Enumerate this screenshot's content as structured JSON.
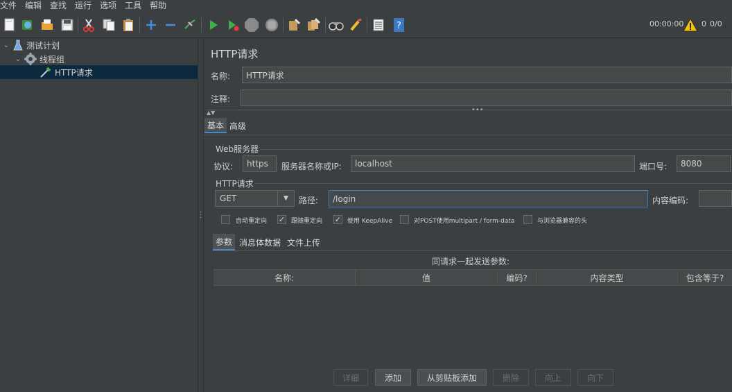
{
  "menu": [
    "文件",
    "编辑",
    "查找",
    "运行",
    "选项",
    "工具",
    "帮助"
  ],
  "toolbar_status": {
    "timer": "00:00:00",
    "warnings": "0",
    "threads": "0/0"
  },
  "tree": {
    "test_plan": "测试计划",
    "thread_group": "线程组",
    "http_request": "HTTP请求"
  },
  "panel": {
    "title": "HTTP请求",
    "name_label": "名称:",
    "name_value": "HTTP请求",
    "comment_label": "注释:",
    "comment_value": ""
  },
  "tabs": {
    "basic": "基本",
    "advanced": "高级"
  },
  "web_server": {
    "group": "Web服务器",
    "protocol_label": "协议:",
    "protocol_value": "https",
    "server_label": "服务器名称或IP:",
    "server_value": "localhost",
    "port_label": "端口号:",
    "port_value": "8080"
  },
  "http_request": {
    "group": "HTTP请求",
    "method": "GET",
    "path_label": "路径:",
    "path_value": "/login",
    "encoding_label": "内容编码:",
    "encoding_value": ""
  },
  "options": [
    {
      "label": "自动重定向",
      "checked": false
    },
    {
      "label": "跟随重定向",
      "checked": true
    },
    {
      "label": "使用 KeepAlive",
      "checked": true
    },
    {
      "label": "对POST使用multipart / form-data",
      "checked": false
    },
    {
      "label": "与浏览器兼容的头",
      "checked": false
    }
  ],
  "subtabs": {
    "params": "参数",
    "body": "消息体数据",
    "files": "文件上传"
  },
  "params_caption": "同请求一起发送参数:",
  "columns": [
    "名称:",
    "值",
    "编码?",
    "内容类型",
    "包含等于?"
  ],
  "buttons": {
    "detail": "详细",
    "add": "添加",
    "add_clipboard": "从剪贴板添加",
    "delete": "删除",
    "up": "向上",
    "down": "向下"
  }
}
